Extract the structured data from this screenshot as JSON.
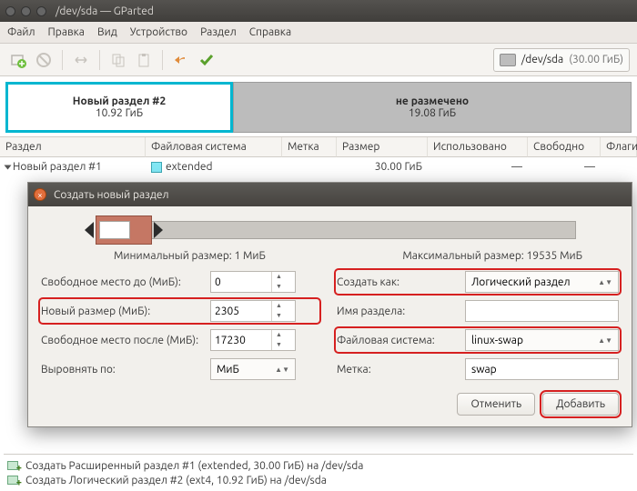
{
  "window": {
    "title": "/dev/sda — GParted"
  },
  "menu": {
    "file": "Файл",
    "edit": "Правка",
    "view": "Вид",
    "device": "Устройство",
    "partition": "Раздел",
    "help": "Справка"
  },
  "device_selector": {
    "device": "/dev/sda",
    "size": "(30.00 ГиБ)"
  },
  "disk": {
    "seg1_name": "Новый раздел #2",
    "seg1_size": "10.92 ГиБ",
    "seg2_name": "не размечено",
    "seg2_size": "19.08 ГиБ"
  },
  "cols": {
    "partition": "Раздел",
    "fs": "Файловая система",
    "label": "Метка",
    "size": "Размер",
    "used": "Использовано",
    "free": "Свободно",
    "flags": "Флаги"
  },
  "row1": {
    "name": "Новый раздел #1",
    "fs": "extended",
    "size": "30.00 ГиБ",
    "used": "—",
    "free": "—"
  },
  "dialog": {
    "title": "Создать новый раздел",
    "min_label": "Минимальный размер: 1 МиБ",
    "max_label": "Максимальный размер: 19535 МиБ",
    "free_before_label": "Свободное место до (МиБ):",
    "free_before": "0",
    "new_size_label": "Новый размер (МиБ):",
    "new_size": "2305",
    "free_after_label": "Свободное место после (МиБ):",
    "free_after": "17230",
    "align_label": "Выровнять по:",
    "align_value": "МиБ",
    "create_as_label": "Создать как:",
    "create_as_value": "Логический раздел",
    "part_name_label": "Имя раздела:",
    "part_name_value": "",
    "fs_label": "Файловая система:",
    "fs_value": "linux-swap",
    "label_label": "Метка:",
    "label_value": "swap",
    "cancel": "Отменить",
    "add": "Добавить"
  },
  "pending": {
    "op1": "Создать Расширенный раздел #1 (extended, 30.00 ГиБ) на /dev/sda",
    "op2": "Создать Логический раздел #2 (ext4, 10.92 ГиБ) на /dev/sda"
  }
}
